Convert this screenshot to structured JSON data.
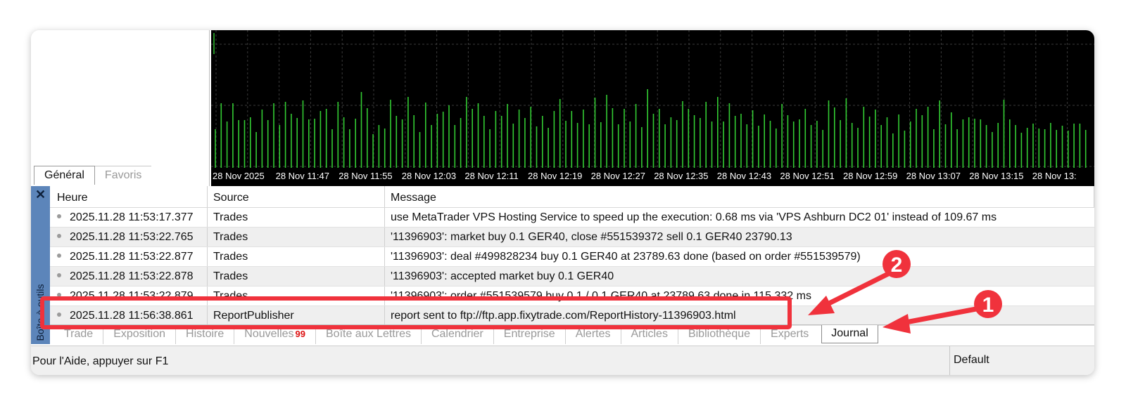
{
  "navigator": {
    "tabs": [
      {
        "label": "Général",
        "active": true
      },
      {
        "label": "Favoris",
        "active": false
      }
    ]
  },
  "chart_data": {
    "type": "bar",
    "background": "#000000",
    "bar_color": "#33cc33",
    "grid_color": "#3a3a3a",
    "x_tick_labels": [
      "28 Nov 2025",
      "28 Nov 11:47",
      "28 Nov 11:55",
      "28 Nov 12:03",
      "28 Nov 12:11",
      "28 Nov 12:19",
      "28 Nov 12:27",
      "28 Nov 12:35",
      "28 Nov 12:43",
      "28 Nov 12:51",
      "28 Nov 12:59",
      "28 Nov 13:07",
      "28 Nov 13:15",
      "28 Nov 13:"
    ],
    "values": [
      55,
      92,
      66,
      92,
      68,
      68,
      72,
      51,
      83,
      68,
      92,
      61,
      94,
      77,
      71,
      96,
      69,
      70,
      81,
      84,
      55,
      94,
      72,
      55,
      70,
      108,
      85,
      48,
      61,
      56,
      97,
      74,
      69,
      101,
      75,
      51,
      93,
      61,
      77,
      80,
      89,
      61,
      71,
      101,
      84,
      92,
      74,
      55,
      81,
      74,
      91,
      63,
      83,
      71,
      87,
      59,
      74,
      57,
      81,
      98,
      67,
      81,
      64,
      83,
      62,
      100,
      65,
      104,
      85,
      62,
      84,
      66,
      91,
      58,
      112,
      77,
      84,
      62,
      72,
      68,
      95,
      84,
      75,
      71,
      94,
      66,
      101,
      66,
      92,
      74,
      77,
      62,
      82,
      60,
      76,
      67,
      56,
      91,
      75,
      66,
      69,
      84,
      61,
      67,
      54,
      96,
      86,
      68,
      99,
      64,
      57,
      87,
      73,
      83,
      61,
      72,
      49,
      76,
      53,
      66,
      84,
      75,
      87,
      55,
      96,
      62,
      79,
      55,
      69,
      72,
      70,
      69,
      61,
      51,
      64,
      97,
      69,
      61,
      50,
      57,
      63,
      56,
      55,
      64,
      54,
      60,
      53,
      63,
      63,
      54
    ],
    "ylim": [
      0,
      222
    ]
  },
  "sidebar": {
    "close_label": "✕",
    "vertical_label": "Boîte à outils"
  },
  "journal": {
    "columns": [
      "Heure",
      "Source",
      "Message"
    ],
    "rows": [
      {
        "time": "2025.11.28 11:53:17.377",
        "source": "Trades",
        "message": "use MetaTrader VPS Hosting Service to speed up the execution: 0.68 ms via 'VPS Ashburn DC2 01' instead of 109.67 ms"
      },
      {
        "time": "2025.11.28 11:53:22.765",
        "source": "Trades",
        "message": "'11396903': market buy 0.1 GER40, close #551539372 sell 0.1 GER40 23790.13"
      },
      {
        "time": "2025.11.28 11:53:22.877",
        "source": "Trades",
        "message": "'11396903': deal #499828234 buy 0.1 GER40 at 23789.63 done (based on order #551539579)"
      },
      {
        "time": "2025.11.28 11:53:22.878",
        "source": "Trades",
        "message": "'11396903': accepted market buy 0.1 GER40"
      },
      {
        "time": "2025.11.28 11:53:22.879",
        "source": "Trades",
        "message": "'11396903': order #551539579 buy 0.1 / 0.1 GER40 at 23789.63 done in 115.332 ms"
      },
      {
        "time": "2025.11.28 11:56:38.861",
        "source": "ReportPublisher",
        "message": "report sent to ftp://ftp.app.fixytrade.com/ReportHistory-11396903.html"
      }
    ]
  },
  "bottom_tabs": [
    {
      "label": "Trade",
      "badge": ""
    },
    {
      "label": "Exposition",
      "badge": ""
    },
    {
      "label": "Histoire",
      "badge": ""
    },
    {
      "label": "Nouvelles",
      "badge": "99"
    },
    {
      "label": "Boîte aux Lettres",
      "badge": ""
    },
    {
      "label": "Calendrier",
      "badge": ""
    },
    {
      "label": "Entreprise",
      "badge": ""
    },
    {
      "label": "Alertes",
      "badge": ""
    },
    {
      "label": "Articles",
      "badge": ""
    },
    {
      "label": "Bibliothèque",
      "badge": ""
    },
    {
      "label": "Experts",
      "badge": ""
    },
    {
      "label": "Journal",
      "badge": "",
      "active": true
    }
  ],
  "statusbar": {
    "help_text": "Pour l'Aide, appuyer sur F1",
    "profile": "Default"
  },
  "annotations": {
    "color": "#f0323c",
    "markers": [
      "1",
      "2"
    ]
  }
}
